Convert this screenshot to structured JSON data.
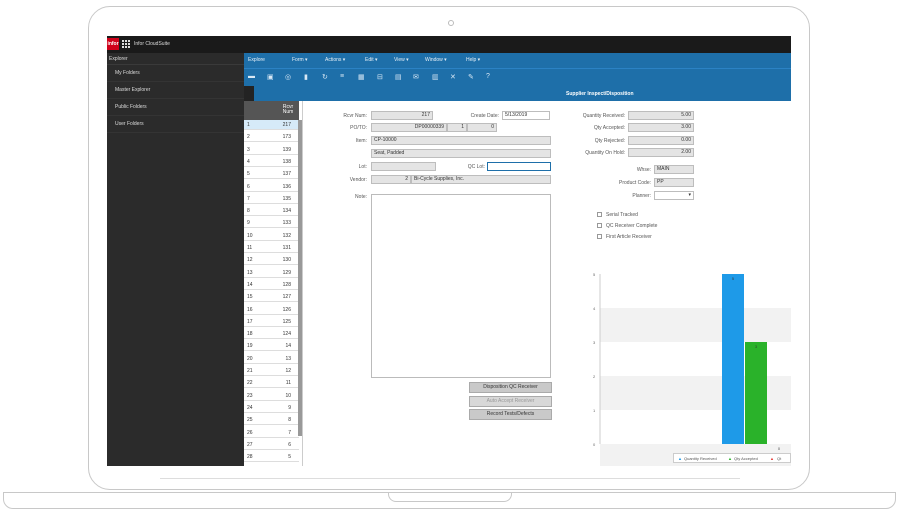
{
  "app": {
    "brand": "infor",
    "title": "Infor CloudSuite"
  },
  "sidebar": {
    "header": "Explorer",
    "items": [
      {
        "label": "My Folders"
      },
      {
        "label": "Master Explorer"
      },
      {
        "label": "Public Folders"
      },
      {
        "label": "User Folders"
      }
    ]
  },
  "menu": [
    "Explore",
    "Form ▾",
    "Actions ▾",
    "Edit ▾",
    "View ▾",
    "Window ▾",
    "Help ▾"
  ],
  "toolbar_icons": [
    "folder-icon",
    "save-icon",
    "globe-icon",
    "delete-icon",
    "refresh-icon",
    "filter-icon",
    "grid-icon",
    "print-icon",
    "document-icon",
    "mail-icon",
    "doc-icon",
    "tools-icon",
    "pencil-icon",
    "help-icon"
  ],
  "form_title": "Supplier Inspect/Disposition",
  "grid": {
    "header": "Rcvr Num",
    "rows": [
      {
        "n": "1",
        "v": "217"
      },
      {
        "n": "2",
        "v": "173"
      },
      {
        "n": "3",
        "v": "139"
      },
      {
        "n": "4",
        "v": "138"
      },
      {
        "n": "5",
        "v": "137"
      },
      {
        "n": "6",
        "v": "136"
      },
      {
        "n": "7",
        "v": "135"
      },
      {
        "n": "8",
        "v": "134"
      },
      {
        "n": "9",
        "v": "133"
      },
      {
        "n": "10",
        "v": "132"
      },
      {
        "n": "11",
        "v": "131"
      },
      {
        "n": "12",
        "v": "130"
      },
      {
        "n": "13",
        "v": "129"
      },
      {
        "n": "14",
        "v": "128"
      },
      {
        "n": "15",
        "v": "127"
      },
      {
        "n": "16",
        "v": "126"
      },
      {
        "n": "17",
        "v": "125"
      },
      {
        "n": "18",
        "v": "124"
      },
      {
        "n": "19",
        "v": "14"
      },
      {
        "n": "20",
        "v": "13"
      },
      {
        "n": "21",
        "v": "12"
      },
      {
        "n": "22",
        "v": "11"
      },
      {
        "n": "23",
        "v": "10"
      },
      {
        "n": "24",
        "v": "9"
      },
      {
        "n": "25",
        "v": "8"
      },
      {
        "n": "26",
        "v": "7"
      },
      {
        "n": "27",
        "v": "6"
      },
      {
        "n": "28",
        "v": "5"
      }
    ]
  },
  "form": {
    "rcvr_num_label": "Rcvr Num:",
    "rcvr_num": "217",
    "create_date_label": "Create Date:",
    "create_date": "5/13/2019",
    "po_to_label": "PO/TO:",
    "po": "DP00000339",
    "po_line": "1",
    "po_rel": "0",
    "item_label": "Item:",
    "item": "CP-10000",
    "item_desc": "Seat, Padded",
    "lot_label": "Lot:",
    "lot": "",
    "qc_lot_label": "QC Lot:",
    "qc_lot": "",
    "vendor_label": "Vendor:",
    "vendor_num": "2",
    "vendor_name": "Bi-Cycle Supplies, Inc.",
    "note_label": "Note:",
    "qty_received_label": "Quantity Received:",
    "qty_received": "5.00",
    "qty_accepted_label": "Qty Accepted:",
    "qty_accepted": "3.00",
    "qty_rejected_label": "Qty Rejected:",
    "qty_rejected": "0.00",
    "qty_on_hold_label": "Quantity On Hold:",
    "qty_on_hold": "2.00",
    "whse_label": "Whse:",
    "whse": "MAIN",
    "product_code_label": "Product Code:",
    "product_code": "PP",
    "planner_label": "Planner:",
    "planner": "",
    "serial_tracked": "Serial Tracked",
    "qc_receiver_complete": "QC Receiver Complete",
    "first_article_receiver": "First Article Receiver"
  },
  "buttons": {
    "disposition": "Disposition QC Receiver",
    "auto_accept": "Auto Accept Receiver",
    "record_tests": "Record Tests/Defects"
  },
  "chart_data": {
    "type": "bar",
    "categories": [
      ""
    ],
    "series": [
      {
        "name": "Quantity Received",
        "values": [
          5
        ],
        "color": "#1e9ae8"
      },
      {
        "name": "Qty Accepted",
        "values": [
          3
        ],
        "color": "#2ab22a"
      },
      {
        "name": "Qt",
        "values": [
          0
        ],
        "color": "#e53935"
      }
    ],
    "data_labels": [
      "5",
      "3",
      "0"
    ],
    "ylim": [
      0,
      5
    ],
    "yticks": [
      "5",
      "4",
      "3",
      "2",
      "1",
      "0"
    ],
    "grid": true,
    "legend": "bottom-right"
  }
}
